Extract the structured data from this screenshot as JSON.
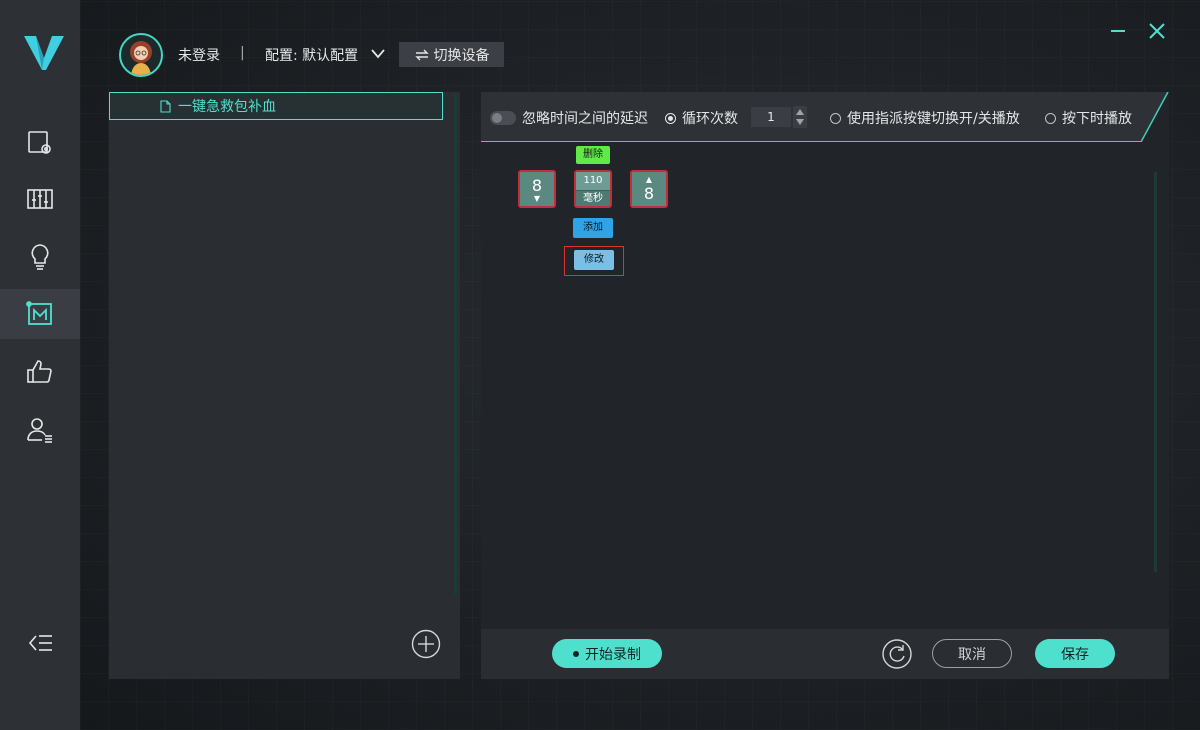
{
  "header": {
    "login_status": "未登录",
    "separator": "|",
    "config_label": "配置: 默认配置",
    "switch_device_label": "切换设备"
  },
  "macro_list": {
    "items": [
      {
        "label": "一键急救包补血",
        "icon": "file-icon",
        "selected": true
      }
    ]
  },
  "options": {
    "ignore_delay_label": "忽略时间之间的延迟",
    "loop_label": "循环次数",
    "loop_count": "1",
    "toggle_mode_label": "使用指派按键切换开/关播放",
    "hold_mode_label": "按下时播放",
    "selected_mode": "loop"
  },
  "macro_sequence": {
    "key_down": {
      "key": "8",
      "arrow": "▼"
    },
    "delay": {
      "value": "110",
      "unit": "毫秒"
    },
    "key_up": {
      "key": "8",
      "arrow": "▲"
    },
    "delete_label": "删除",
    "add_label": "添加",
    "modify_label": "修改"
  },
  "bottom": {
    "record_label": "开始录制",
    "cancel_label": "取消",
    "save_label": "保存"
  },
  "colors": {
    "accent": "#4fe0cd",
    "sidebar": "#2d3035",
    "delete": "#5fea4a",
    "add": "#2fa3e6",
    "highlight_border": "#c0303a"
  }
}
